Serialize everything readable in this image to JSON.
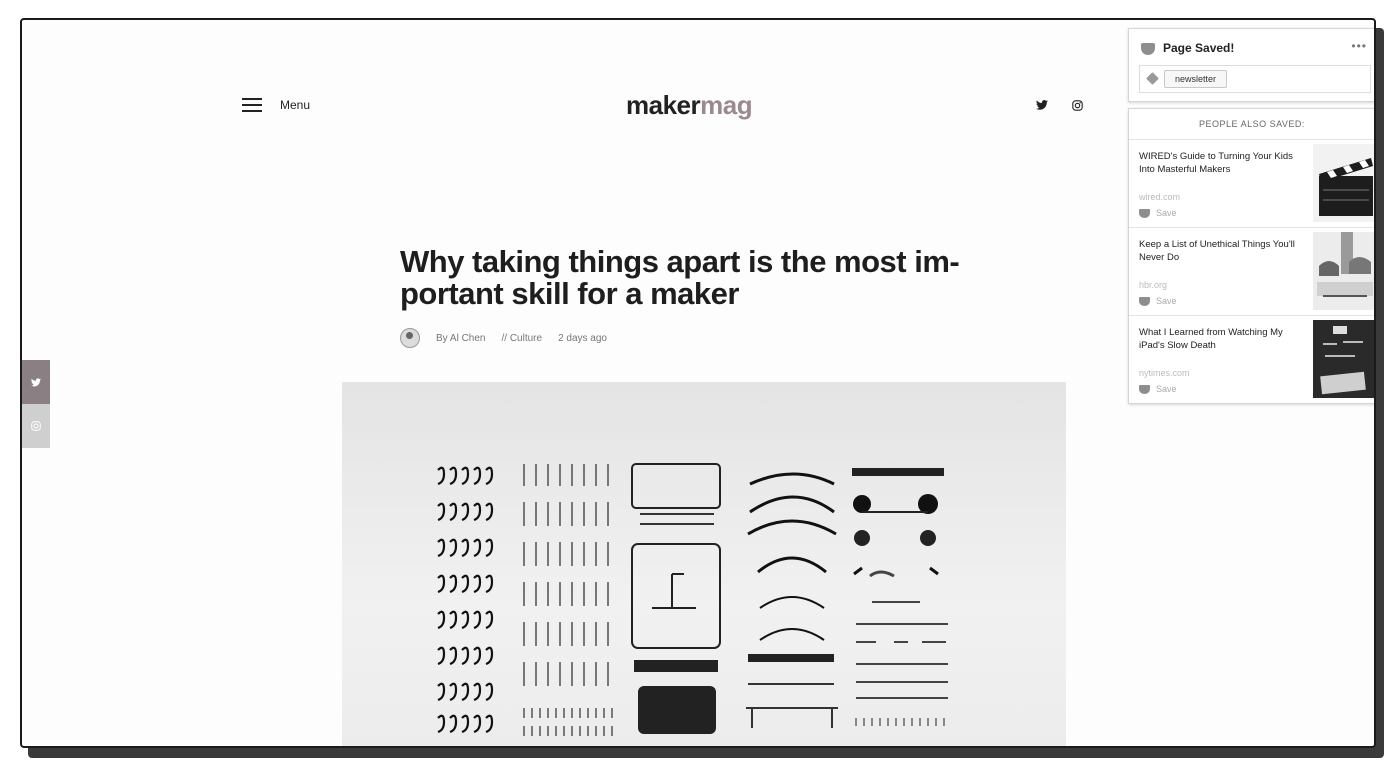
{
  "header": {
    "menu_label": "Menu",
    "logo_part1": "maker",
    "logo_part2": "mag",
    "social_icons": [
      "twitter-icon",
      "instagram-icon"
    ]
  },
  "article": {
    "title": "Why taking things apart is the most im-portant skill for a maker",
    "author": "By Al Chen",
    "category": "// Culture",
    "time": "2 days ago"
  },
  "pocket": {
    "saved_title": "Page Saved!",
    "tag": "newsletter",
    "also_saved_heading": "PEOPLE ALSO SAVED:",
    "items": [
      {
        "title": "WIRED's Guide to Turning Your Kids Into Masterful Makers",
        "domain": "wired.com",
        "save_label": "Save"
      },
      {
        "title": "Keep a List of Unethical Things You'll Never Do",
        "domain": "hbr.org",
        "save_label": "Save"
      },
      {
        "title": "What I Learned from Watching My iPad's Slow Death",
        "domain": "nytimes.com",
        "save_label": "Save"
      }
    ]
  },
  "colors": {
    "logo_accent": "#9a8a8d",
    "share_twitter_bg": "#8a7f82",
    "share_instagram_bg": "#cfcfcf"
  }
}
